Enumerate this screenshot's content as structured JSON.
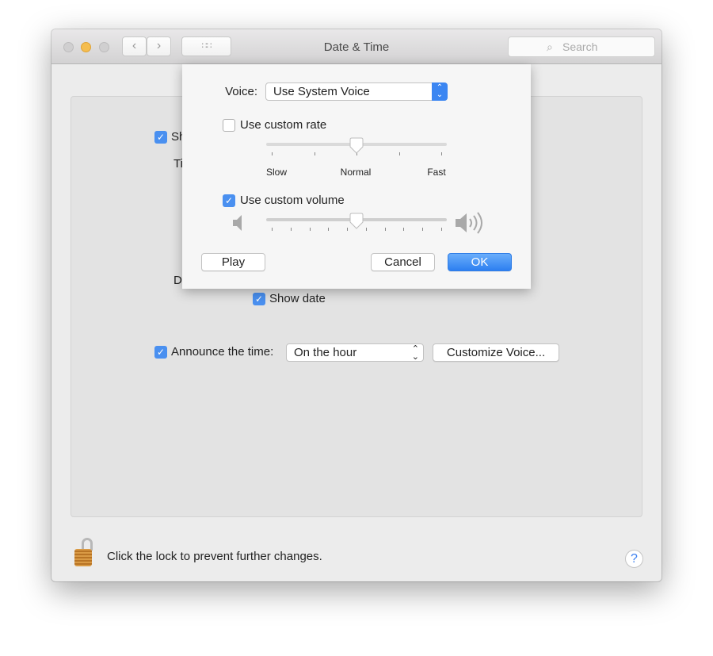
{
  "window": {
    "title": "Date & Time",
    "search_placeholder": "Search",
    "back_icon": "chevron-left-icon",
    "forward_icon": "chevron-right-icon",
    "grid_icon": "grid-icon"
  },
  "background": {
    "show_fragment": "Sh",
    "show_checked": true,
    "time_fragment": "Ti",
    "date_fragment": "D",
    "show_date_label": "Show date",
    "show_date_checked": true,
    "announce_label": "Announce the time:",
    "announce_checked": true,
    "announce_value": "On the hour",
    "customize_label": "Customize Voice..."
  },
  "sheet": {
    "voice_label": "Voice:",
    "voice_value": "Use System Voice",
    "rate_label": "Use custom rate",
    "rate_checked": false,
    "rate_value": 0.5,
    "rate_ticks": [
      "Slow",
      "Normal",
      "Fast"
    ],
    "volume_label": "Use custom volume",
    "volume_checked": true,
    "volume_value": 0.5,
    "play": "Play",
    "cancel": "Cancel",
    "ok": "OK"
  },
  "footer": {
    "lock_text": "Click the lock to prevent further changes.",
    "help": "?"
  },
  "colors": {
    "accent": "#2d7ff0",
    "close": "#d0cfd0",
    "minimize": "#f5bd4f"
  }
}
